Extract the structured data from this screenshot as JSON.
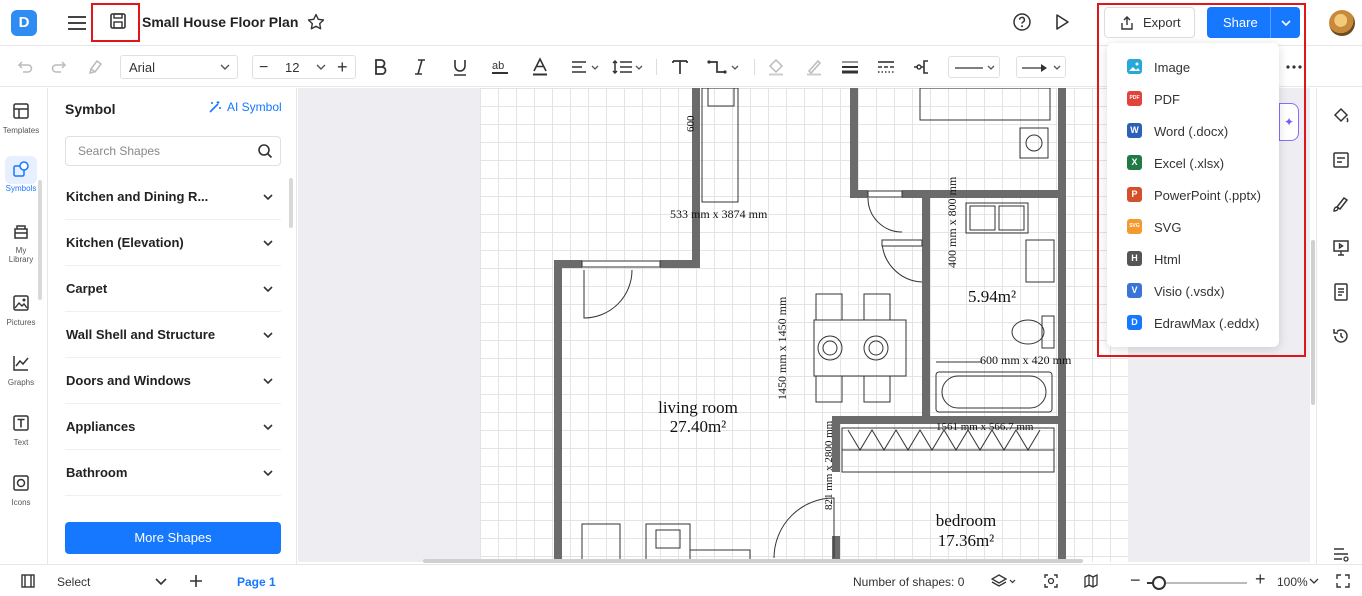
{
  "header": {
    "title": "Small House Floor Plan",
    "export_label": "Export",
    "share_label": "Share"
  },
  "toolbar": {
    "font_family": "Arial",
    "font_size": "12"
  },
  "rail": {
    "items": [
      {
        "label": "Templates",
        "icon": "templates-icon"
      },
      {
        "label": "Symbols",
        "icon": "symbols-icon"
      },
      {
        "label": "My",
        "label2": "Library",
        "icon": "library-icon"
      },
      {
        "label": "Pictures",
        "icon": "pictures-icon"
      },
      {
        "label": "Graphs",
        "icon": "graphs-icon"
      },
      {
        "label": "Text",
        "icon": "text-icon"
      },
      {
        "label": "Icons",
        "icon": "icons-icon"
      }
    ]
  },
  "panel": {
    "title": "Symbol",
    "ai_label": "AI Symbol",
    "search_placeholder": "Search Shapes",
    "categories": [
      "Kitchen and Dining R...",
      "Kitchen (Elevation)",
      "Carpet",
      "Wall Shell and Structure",
      "Doors and Windows",
      "Appliances",
      "Bathroom"
    ],
    "more_shapes": "More Shapes"
  },
  "plan": {
    "dim1": "533 mm x 3874 mm",
    "dim2": "400 mm x 800 mm",
    "dim3": "1450 mm x 1450 mm",
    "dim4": "600 mm x 420 mm",
    "dim5": "1561 mm x 566.7 mm",
    "dim6": "600",
    "dim7": "821 mm x 2800 mm",
    "bath_area": "5.94m²",
    "living_name": "living room",
    "living_area": "27.40m²",
    "bedroom_name": "bedroom",
    "bedroom_area": "17.36m²"
  },
  "export_menu": {
    "items": [
      {
        "label": "Image",
        "badge": "",
        "color": "#28a8d8"
      },
      {
        "label": "PDF",
        "badge": "PDF",
        "color": "#e0443a"
      },
      {
        "label": "Word (.docx)",
        "badge": "W",
        "color": "#2b5fb8"
      },
      {
        "label": "Excel (.xlsx)",
        "badge": "X",
        "color": "#1f7a45"
      },
      {
        "label": "PowerPoint (.pptx)",
        "badge": "P",
        "color": "#d2502c"
      },
      {
        "label": "SVG",
        "badge": "SVG",
        "color": "#f29a2e"
      },
      {
        "label": "Html",
        "badge": "H",
        "color": "#555555"
      },
      {
        "label": "Visio (.vsdx)",
        "badge": "V",
        "color": "#3b74d8"
      },
      {
        "label": "EdrawMax (.eddx)",
        "badge": "D",
        "color": "#1677ff"
      }
    ]
  },
  "status": {
    "mode": "Select",
    "page": "Page 1",
    "shapes_count": "Number of shapes: 0",
    "zoom": "100%"
  },
  "colors": {
    "accent": "#1677ff",
    "highlight": "#e0161b"
  }
}
